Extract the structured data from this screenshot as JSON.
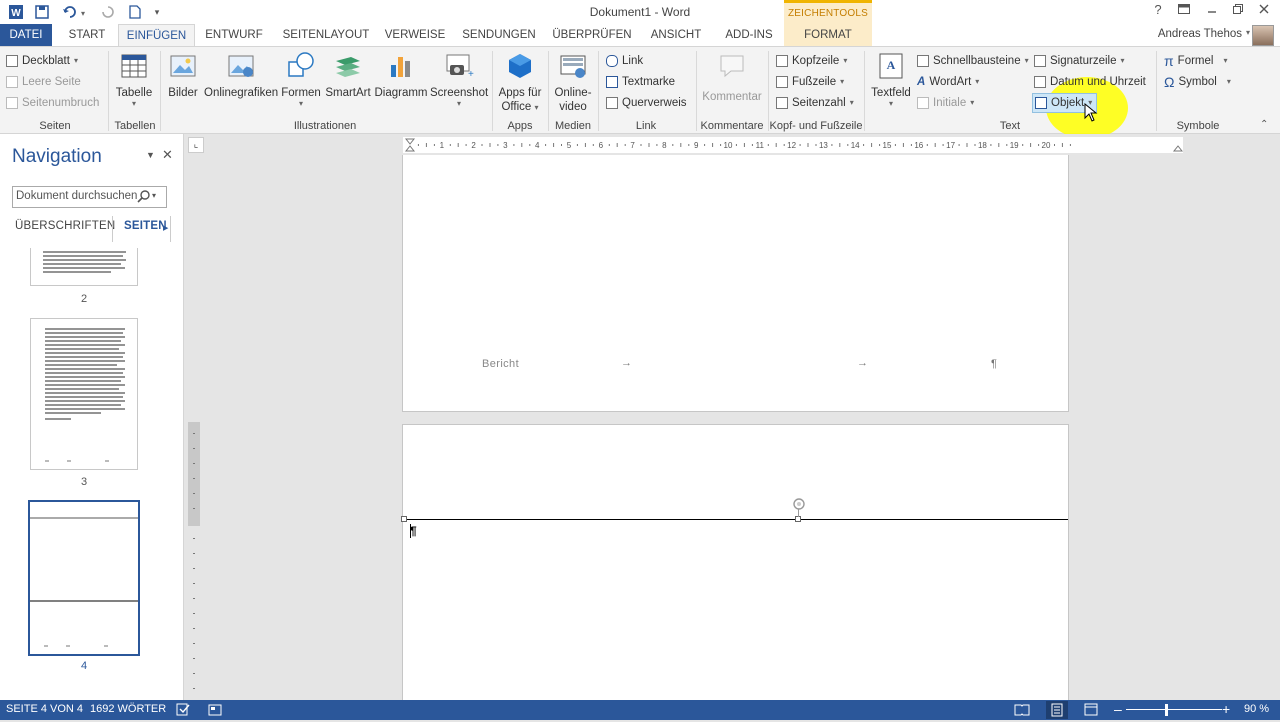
{
  "window": {
    "title": "Dokument1 - Word",
    "help": "?",
    "controls": [
      "❐",
      "–",
      "❐",
      "✕"
    ]
  },
  "context_tab": {
    "group": "ZEICHENTOOLS",
    "tab": "FORMAT"
  },
  "tabs": [
    "DATEI",
    "START",
    "EINFÜGEN",
    "ENTWURF",
    "SEITENLAYOUT",
    "VERWEISE",
    "SENDUNGEN",
    "ÜBERPRÜFEN",
    "ANSICHT",
    "ADD-INS"
  ],
  "active_tab": "EINFÜGEN",
  "user": {
    "name": "Andreas Thehos"
  },
  "ribbon": {
    "seiten": {
      "label": "Seiten",
      "deckblatt": "Deckblatt",
      "leere_seite": "Leere Seite",
      "seitenumbruch": "Seitenumbruch"
    },
    "tabellen": {
      "label": "Tabellen",
      "tabelle": "Tabelle"
    },
    "illustrationen": {
      "label": "Illustrationen",
      "bilder": "Bilder",
      "onlinegrafiken": "Onlinegrafiken",
      "formen": "Formen",
      "smartart": "SmartArt",
      "diagramm": "Diagramm",
      "screenshot": "Screenshot"
    },
    "apps": {
      "label": "Apps",
      "apps_fuer_1": "Apps für",
      "apps_fuer_2": "Office"
    },
    "medien": {
      "label": "Medien",
      "online_1": "Online-",
      "online_2": "video"
    },
    "link": {
      "label": "Link",
      "link": "Link",
      "textmarke": "Textmarke",
      "querverweis": "Querverweis"
    },
    "kommentare": {
      "label": "Kommentare",
      "kommentar": "Kommentar"
    },
    "kopf": {
      "label": "Kopf- und Fußzeile",
      "kopfzeile": "Kopfzeile",
      "fusszeile": "Fußzeile",
      "seitenzahl": "Seitenzahl"
    },
    "text": {
      "label": "Text",
      "textfeld": "Textfeld",
      "schnellbausteine": "Schnellbausteine",
      "wordart": "WordArt",
      "initiale": "Initiale",
      "signaturzeile": "Signaturzeile",
      "datum": "Datum und Uhrzeit",
      "objekt": "Objekt"
    },
    "symbole": {
      "label": "Symbole",
      "formel": "Formel",
      "symbol": "Symbol"
    }
  },
  "navigation": {
    "title": "Navigation",
    "search_placeholder": "Dokument durchsuchen",
    "tab_headings": "ÜBERSCHRIFTEN",
    "tab_pages": "SEITEN",
    "pages": [
      "2",
      "3",
      "4"
    ],
    "selected_page": "4"
  },
  "document": {
    "footer_text": "Bericht",
    "tab_arrow": "→",
    "pilcrow": "¶"
  },
  "ruler": {
    "numbers": [
      "1",
      "2",
      "3",
      "4",
      "5",
      "6",
      "7",
      "8",
      "9",
      "10",
      "11",
      "12",
      "13",
      "14",
      "15",
      "16",
      "17",
      "18",
      "19",
      "20"
    ]
  },
  "status": {
    "page": "SEITE 4 VON 4",
    "words": "1692 WÖRTER",
    "zoom": "90 %"
  },
  "colors": {
    "accent": "#2b579a",
    "context": "#fcecc9",
    "highlight": "#ffff00"
  }
}
